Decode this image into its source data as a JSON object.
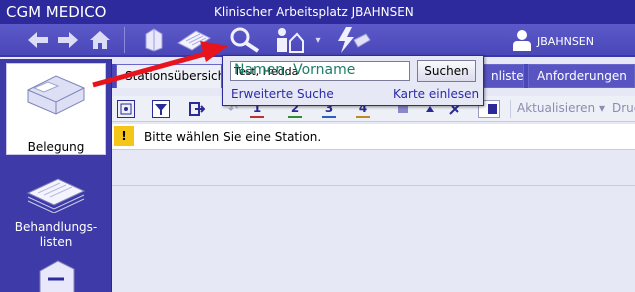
{
  "app": {
    "name": "CGM MEDICO",
    "window_title": "Klinischer Arbeitsplatz JBAHNSEN"
  },
  "user": {
    "name": "JBAHNSEN"
  },
  "toolbar": {
    "icons": [
      "arrow-left-icon",
      "arrow-right-icon",
      "home-icon",
      "hospital-bed-icon",
      "document-icon",
      "search-icon",
      "patient-house-icon",
      "chevron-down-icon",
      "lightning-icon"
    ]
  },
  "sidebar": {
    "items": [
      {
        "label": "Belegung",
        "icon": "bed-icon",
        "active": true
      },
      {
        "label": "Behandlungs-\nlisten",
        "icon": "stacked-lists-icon",
        "active": false
      },
      {
        "label": "",
        "icon": "module-icon",
        "active": false
      }
    ]
  },
  "tabs": [
    {
      "label": "Stationsübersicht",
      "active": true
    },
    {
      "label": "nliste",
      "active": false
    },
    {
      "label": "Anforderungen",
      "active": false
    }
  ],
  "sub_toolbar": {
    "refresh_label": "Aktualisieren",
    "print_label": "Druck",
    "counters": [
      "1",
      "2",
      "3",
      "4"
    ]
  },
  "warning": {
    "text": "Bitte wählen Sie eine Station."
  },
  "search_popup": {
    "input_value": "Test, Hedda",
    "overlay_hint": "Namen, Vorname",
    "search_button": "Suchen",
    "advanced_link": "Erweiterte Suche",
    "card_link": "Karte einlesen"
  },
  "colors": {
    "titlebar": "#2d2a9e",
    "toolbar": "#4a47b8",
    "sidebar": "#3e3ba8",
    "annotation_arrow": "#e8141b",
    "warning": "#f5c518",
    "link": "#2b2aa6",
    "overlay_hint": "#1d7c67"
  }
}
